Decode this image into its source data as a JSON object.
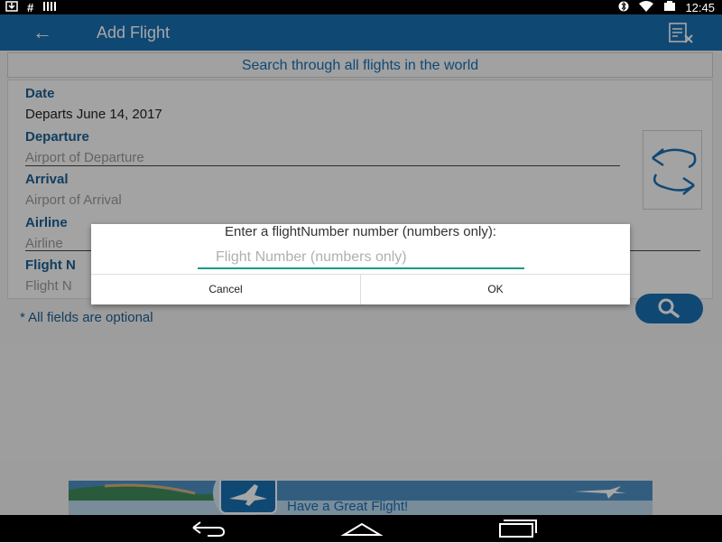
{
  "status_bar": {
    "time": "12:45",
    "left_icons": [
      "download-icon",
      "hash-icon",
      "barcode-icon"
    ],
    "right_icons": [
      "bluetooth-icon",
      "wifi-icon",
      "battery-icon"
    ]
  },
  "app_bar": {
    "title": "Add Flight",
    "back_icon": "arrow-left-icon",
    "action_icon": "clear-form-icon"
  },
  "form": {
    "banner": "Search through all flights in the world",
    "date_label": "Date",
    "date_value": "Departs June 14, 2017",
    "departure_label": "Departure",
    "departure_placeholder": "Airport of Departure",
    "arrival_label": "Arrival",
    "arrival_placeholder": "Airport of Arrival",
    "airline_label": "Airline",
    "airline_placeholder": "Airline",
    "flight_label": "Flight N",
    "flight_placeholder": "Flight N",
    "note": "* All fields are optional"
  },
  "dialog": {
    "message": "Enter a flightNumber number (numbers only):",
    "input_placeholder": "Flight Number (numbers only)",
    "cancel_label": "Cancel",
    "ok_label": "OK"
  },
  "ad": {
    "text": "Have a Great Flight!"
  },
  "colors": {
    "primary": "#1a6fb3",
    "label": "#1b5f93",
    "accent_input": "#149a8c"
  }
}
